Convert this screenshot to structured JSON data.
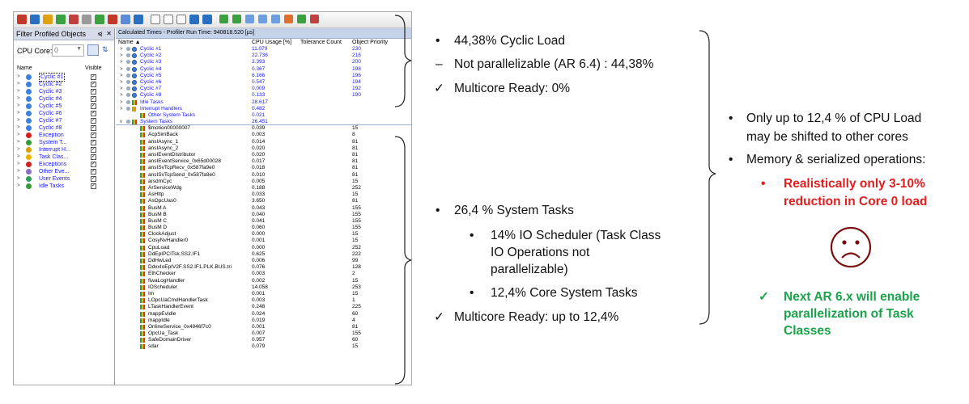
{
  "left_panel": {
    "title": "Filter Profiled Objects",
    "pin_glyph": "⩿",
    "close_glyph": "✕",
    "cpu_core_label": "CPU Core:",
    "cpu_core_value": "0",
    "column_name": "Name",
    "column_visible": "Visible",
    "items": [
      {
        "label": "Cyclic #1",
        "icon": "cyclic-icon",
        "selected": true
      },
      {
        "label": "Cyclic #2",
        "icon": "cyclic-icon"
      },
      {
        "label": "Cyclic #3",
        "icon": "cyclic-icon"
      },
      {
        "label": "Cyclic #4",
        "icon": "cyclic-icon"
      },
      {
        "label": "Cyclic #5",
        "icon": "cyclic-icon"
      },
      {
        "label": "Cyclic #6",
        "icon": "cyclic-icon"
      },
      {
        "label": "Cyclic #7",
        "icon": "cyclic-icon"
      },
      {
        "label": "Cyclic #8",
        "icon": "cyclic-icon"
      },
      {
        "label": "Exception",
        "icon": "exception-icon"
      },
      {
        "label": "System T...",
        "icon": "system-tasks-icon"
      },
      {
        "label": "Interrupt H...",
        "icon": "interrupt-icon"
      },
      {
        "label": "Task Clas...",
        "icon": "task-class-icon"
      },
      {
        "label": "Exceptions",
        "icon": "exceptions-icon"
      },
      {
        "label": "Other Eve...",
        "icon": "other-events-icon"
      },
      {
        "label": "User Events",
        "icon": "user-events-icon"
      },
      {
        "label": "Idle Tasks",
        "icon": "idle-tasks-icon"
      }
    ]
  },
  "right_panel": {
    "title": "Calculated Times - Profiler Run Time: 940818.520 [µs]",
    "columns": {
      "name": "Name",
      "cpu_usage": "CPU Usage [%]",
      "tolerance": "Tolerance Count",
      "priority": "Object Priority"
    },
    "rows": [
      {
        "name": "Cyclic #1",
        "cpu": "11.079",
        "prio": "230",
        "level": 0,
        "icon": "cyc",
        "blue": true
      },
      {
        "name": "Cyclic #2",
        "cpu": "22.736",
        "prio": "218",
        "level": 0,
        "icon": "cyc",
        "blue": true
      },
      {
        "name": "Cyclic #3",
        "cpu": "3.393",
        "prio": "200",
        "level": 0,
        "icon": "cyc",
        "blue": true
      },
      {
        "name": "Cyclic #4",
        "cpu": "0.367",
        "prio": "198",
        "level": 0,
        "icon": "cyc",
        "blue": true
      },
      {
        "name": "Cyclic #5",
        "cpu": "6.166",
        "prio": "196",
        "level": 0,
        "icon": "cyc",
        "blue": true
      },
      {
        "name": "Cyclic #6",
        "cpu": "0.547",
        "prio": "194",
        "level": 0,
        "icon": "cyc",
        "blue": true
      },
      {
        "name": "Cyclic #7",
        "cpu": "0.009",
        "prio": "192",
        "level": 0,
        "icon": "cyc",
        "blue": true
      },
      {
        "name": "Cyclic #8",
        "cpu": "0.133",
        "prio": "190",
        "level": 0,
        "icon": "cyc",
        "blue": true
      },
      {
        "name": "Idle Tasks",
        "cpu": "28.617",
        "prio": "",
        "level": 0,
        "icon": "bar",
        "blue": true
      },
      {
        "name": "Interrupt Handlers",
        "cpu": "0.482",
        "prio": "",
        "level": 0,
        "icon": "flg",
        "blue": true
      },
      {
        "name": "Other System Tasks",
        "cpu": "0.021",
        "prio": "",
        "level": 1,
        "icon": "bar",
        "blue": true
      },
      {
        "name": "System Tasks",
        "cpu": "26.451",
        "prio": "",
        "level": 0,
        "icon": "bar",
        "blue": true,
        "open": true
      },
      {
        "name": "$motion00000007",
        "cpu": "0.039",
        "prio": "15",
        "level": 2,
        "icon": "bar"
      },
      {
        "name": "AcpSimBack",
        "cpu": "0.003",
        "prio": "8",
        "level": 2,
        "icon": "bar"
      },
      {
        "name": "ansIAsync_1",
        "cpu": "0.014",
        "prio": "81",
        "level": 2,
        "icon": "bar"
      },
      {
        "name": "ansIAsync_2",
        "cpu": "0.020",
        "prio": "81",
        "level": 2,
        "icon": "bar"
      },
      {
        "name": "ansIEventDistributor",
        "cpu": "0.020",
        "prio": "81",
        "level": 2,
        "icon": "bar"
      },
      {
        "name": "ansIEventService_0x65d00028",
        "cpu": "0.017",
        "prio": "81",
        "level": 2,
        "icon": "bar"
      },
      {
        "name": "ansISvTcpRecv_0x587fa9e0",
        "cpu": "0.018",
        "prio": "81",
        "level": 2,
        "icon": "bar"
      },
      {
        "name": "ansISvTcpSend_0x587fa9e0",
        "cpu": "0.010",
        "prio": "81",
        "level": 2,
        "icon": "bar"
      },
      {
        "name": "arsdmCyc",
        "cpu": "0.005",
        "prio": "15",
        "level": 2,
        "icon": "bar"
      },
      {
        "name": "ArServiceWdg",
        "cpu": "0.188",
        "prio": "252",
        "level": 2,
        "icon": "bar"
      },
      {
        "name": "AsHttp",
        "cpu": "0.033",
        "prio": "15",
        "level": 2,
        "icon": "bar"
      },
      {
        "name": "AsOpcUas0",
        "cpu": "3.650",
        "prio": "81",
        "level": 2,
        "icon": "bar"
      },
      {
        "name": "BusM A",
        "cpu": "0.043",
        "prio": "155",
        "level": 2,
        "icon": "bar"
      },
      {
        "name": "BusM B",
        "cpu": "0.040",
        "prio": "155",
        "level": 2,
        "icon": "bar"
      },
      {
        "name": "BusM C",
        "cpu": "0.041",
        "prio": "155",
        "level": 2,
        "icon": "bar"
      },
      {
        "name": "BusM D",
        "cpu": "0.060",
        "prio": "155",
        "level": 2,
        "icon": "bar"
      },
      {
        "name": "ClockAdjust",
        "cpu": "0.000",
        "prio": "15",
        "level": 2,
        "icon": "bar"
      },
      {
        "name": "CosyNvHandler0",
        "cpu": "0.001",
        "prio": "15",
        "level": 2,
        "icon": "bar"
      },
      {
        "name": "CpuLoad",
        "cpu": "0.000",
        "prio": "252",
        "level": 2,
        "icon": "bar"
      },
      {
        "name": "DdEpIPCITsk.SS2.IF1",
        "cpu": "0.625",
        "prio": "222",
        "level": 2,
        "icon": "bar"
      },
      {
        "name": "DdHwLed",
        "cpu": "0.006",
        "prio": "99",
        "level": 2,
        "icon": "bar"
      },
      {
        "name": "DdxxIoEpIV2F.SS2.IF1.PLK.BUS.tri",
        "cpu": "0.076",
        "prio": "128",
        "level": 2,
        "icon": "bar"
      },
      {
        "name": "EthChecker",
        "cpu": "0.003",
        "prio": "2",
        "level": 2,
        "icon": "bar"
      },
      {
        "name": "fiwaLogHandler",
        "cpu": "0.002",
        "prio": "15",
        "level": 2,
        "icon": "bar"
      },
      {
        "name": "IOScheduler",
        "cpu": "14.058",
        "prio": "253",
        "level": 2,
        "icon": "bar"
      },
      {
        "name": "Im",
        "cpu": "0.001",
        "prio": "15",
        "level": 2,
        "icon": "bar"
      },
      {
        "name": "LOpcUaCmdHandlerTask",
        "cpu": "0.003",
        "prio": "1",
        "level": 2,
        "icon": "bar"
      },
      {
        "name": "LTaskHandlerEvent",
        "cpu": "0.248",
        "prio": "225",
        "level": 2,
        "icon": "bar"
      },
      {
        "name": "mappEvIdle",
        "cpu": "0.024",
        "prio": "60",
        "level": 2,
        "icon": "bar"
      },
      {
        "name": "mappIdle",
        "cpu": "0.019",
        "prio": "4",
        "level": 2,
        "icon": "bar"
      },
      {
        "name": "OnlineService_0x4946f7c0",
        "cpu": "0.001",
        "prio": "81",
        "level": 2,
        "icon": "bar"
      },
      {
        "name": "OpcUa_Task",
        "cpu": "0.007",
        "prio": "155",
        "level": 2,
        "icon": "bar"
      },
      {
        "name": "SafeDomainDriver",
        "cpu": "0.957",
        "prio": "60",
        "level": 2,
        "icon": "bar"
      },
      {
        "name": "sdar",
        "cpu": "0.079",
        "prio": "15",
        "level": 2,
        "icon": "bar"
      }
    ]
  },
  "annotations": {
    "cyclic": [
      {
        "bullet": "•",
        "text": "44,38% Cyclic Load"
      },
      {
        "bullet": "–",
        "text": "Not parallelizable (AR 6.4) : 44,38%"
      },
      {
        "bullet": "✓",
        "text": "Multicore Ready: 0%"
      }
    ],
    "system": {
      "main": {
        "bullet": "•",
        "text": "26,4 % System Tasks"
      },
      "sub1": {
        "bullet": "•",
        "lines": [
          "14% IO Scheduler (Task Class",
          "IO Operations not",
          "parallelizable)"
        ]
      },
      "sub2": {
        "bullet": "•",
        "text": "12,4% Core System Tasks"
      },
      "ready": {
        "bullet": "✓",
        "text": "Multicore Ready: up to 12,4%"
      }
    },
    "summary": {
      "p1": {
        "bullet": "•",
        "lines": [
          "Only up to 12,4 % of CPU Load",
          "may be shifted to other cores"
        ]
      },
      "p2": {
        "bullet": "•",
        "text": "Memory & serialized operations:"
      },
      "p3": {
        "bullet": "•",
        "lines": [
          "Realistically only 3-10%",
          "reduction in Core 0 load"
        ]
      },
      "sad_face": "sad-face-icon",
      "p4": {
        "bullet": "✓",
        "lines": [
          "Next AR 6.x will enable",
          "parallelization of Task",
          "Classes"
        ]
      }
    }
  },
  "colors": {
    "red": "#e02020",
    "green": "#1aa34a",
    "link_blue": "#1a1aff",
    "sad_face": "#7a1010"
  }
}
